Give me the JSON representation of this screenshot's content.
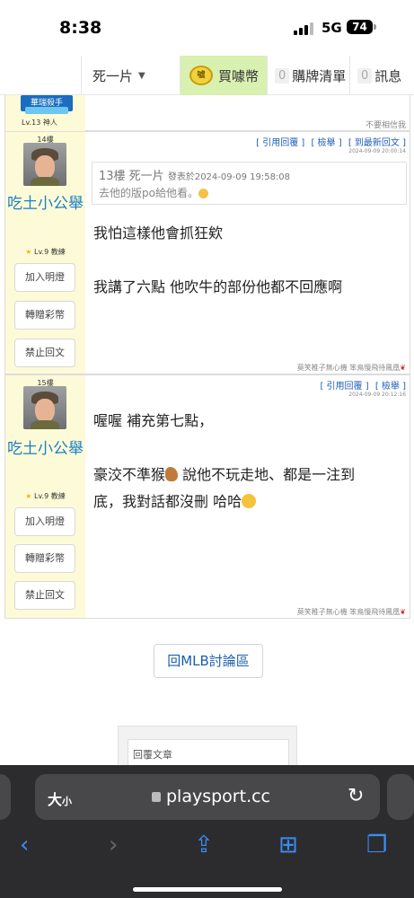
{
  "status_bar": {
    "time": "8:38",
    "network": "5G",
    "battery": "74"
  },
  "nav": {
    "user": "死一片",
    "coin_label": "噓",
    "buy": "買噱幣",
    "cart_count": "0",
    "cart": "購牌清單",
    "msg_count": "0",
    "msg": "訊息"
  },
  "prev_post": {
    "badge": "華瑞殺手",
    "level": "Lv.13 神人",
    "signature": "不要相信我"
  },
  "posts": [
    {
      "floor": "14樓",
      "username": "吃土小公舉",
      "rank": "Lv.9 教練",
      "buttons": [
        "加入明燈",
        "轉贈彩幣",
        "禁止回文"
      ],
      "actions": [
        "[ 引用回覆 ]",
        "[ 檢舉 ]",
        "[ 到最新回文 ]"
      ],
      "time": "2024-09-09 20:00:14",
      "quote_header": "13樓 死一片",
      "quote_meta": "發表於2024-09-09 19:58:08",
      "quote_body": "去他的版po給他看。",
      "lines": [
        "我怕這樣他會抓狂欸",
        "我講了六點 他吹牛的部份他都不回應啊"
      ],
      "signature": "莫笑稚子無心機 笨鳥慢飛待鳳凰"
    },
    {
      "floor": "15樓",
      "username": "吃土小公舉",
      "rank": "Lv.9 教練",
      "buttons": [
        "加入明燈",
        "轉贈彩幣",
        "禁止回文"
      ],
      "actions": [
        "[ 引用回覆 ]",
        "[ 檢舉 ]"
      ],
      "time": "2024-09-09 20:12:16",
      "lines": [
        "喔喔 補充第七點，",
        "豪洨不準猴",
        " 說他不玩走地、都是一注到",
        "底，我對話都沒刪 哈哈"
      ],
      "signature": "莫笑稚子無心機 笨鳥慢飛待鳳凰"
    }
  ],
  "back_button": "回MLB討論區",
  "reply_placeholder": "回覆文章",
  "browser": {
    "text_size": "大",
    "text_size_small": "小",
    "url": "playsport.cc"
  }
}
